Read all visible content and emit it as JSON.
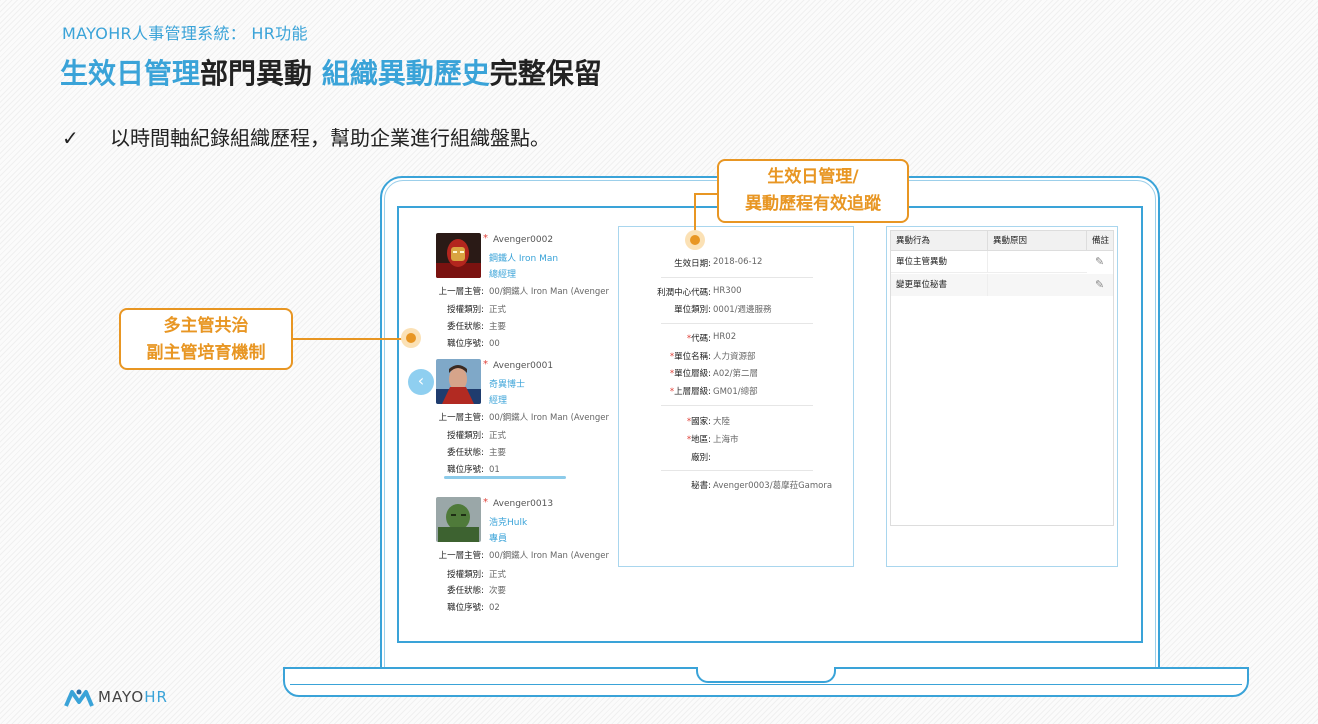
{
  "header": {
    "subtitle": "MAYOHR人事管理系統： HR功能",
    "title_parts": {
      "part1": "生效日管理",
      "part2": "部門異動 ",
      "part3": "組織異動歷史",
      "part4": "完整保留"
    },
    "bullet_check": "✓",
    "bullet_text": "以時間軸紀錄組織歷程，幫助企業進行組織盤點。"
  },
  "callouts": {
    "effective_date": {
      "line1": "生效日管理/",
      "line2": "異動歷程有效追蹤"
    },
    "multi_manager": {
      "line1": "多主管共治",
      "line2": "副主管培育機制"
    }
  },
  "employees": [
    {
      "id": "Avenger0002",
      "name": "鋼鐵人 Iron Man",
      "title": "總經理",
      "fields": [
        {
          "label": "上一層主管:",
          "value": "00/鋼鐵人 Iron Man (Avenger"
        },
        {
          "label": "授權類別:",
          "value": "正式"
        },
        {
          "label": "委任狀態:",
          "value": "主要"
        },
        {
          "label": "職位序號:",
          "value": "00"
        }
      ]
    },
    {
      "id": "Avenger0001",
      "name": "奇異博士",
      "title": "經理",
      "fields": [
        {
          "label": "上一層主管:",
          "value": "00/鋼鐵人 Iron Man  (Avenger"
        },
        {
          "label": "授權類別:",
          "value": "正式"
        },
        {
          "label": "委任狀態:",
          "value": "主要"
        },
        {
          "label": "職位序號:",
          "value": "01"
        }
      ]
    },
    {
      "id": "Avenger0013",
      "name": "浩克Hulk",
      "title": "專員",
      "fields": [
        {
          "label": "上一層主管:",
          "value": "00/鋼鐵人 Iron Man  (Avenger"
        },
        {
          "label": "授權類別:",
          "value": "正式"
        },
        {
          "label": "委任狀態:",
          "value": "次要"
        },
        {
          "label": "職位序號:",
          "value": "02"
        }
      ]
    }
  ],
  "nav": {
    "prev_icon": "‹"
  },
  "detail": {
    "effective_date": {
      "label": "生效日期:",
      "value": "2018-06-12"
    },
    "profit_center": {
      "label": "利潤中心代碼:",
      "value": "HR300"
    },
    "unit_category": {
      "label": "單位類別:",
      "value": "0001/週邊服務"
    },
    "code": {
      "label": "代碼:",
      "value": "HR02"
    },
    "unit_name": {
      "label": "單位名稱:",
      "value": "人力資源部"
    },
    "unit_level": {
      "label": "單位層級:",
      "value": "A02/第二層"
    },
    "parent_level": {
      "label": "上層層級:",
      "value": "GM01/總部"
    },
    "country": {
      "label": "國家:",
      "value": "大陸"
    },
    "region": {
      "label": "地區:",
      "value": "上海市"
    },
    "factory": {
      "label": "廠別:",
      "value": ""
    },
    "secretary": {
      "label": "秘書:",
      "value": "Avenger0003/葛摩菈Gamora"
    },
    "required_mark": "*"
  },
  "change_table": {
    "headers": [
      "異動行為",
      "異動原因",
      "備註"
    ],
    "rows": [
      {
        "action": "單位主管異動",
        "reason": ""
      },
      {
        "action": "變更單位秘書",
        "reason": ""
      }
    ],
    "edit_icon": "✎"
  },
  "logo": {
    "mayo": "MAYO",
    "hr": "HR"
  },
  "colors": {
    "accent": "#3aa3d8",
    "callout": "#e89623",
    "required": "#e0423a"
  }
}
